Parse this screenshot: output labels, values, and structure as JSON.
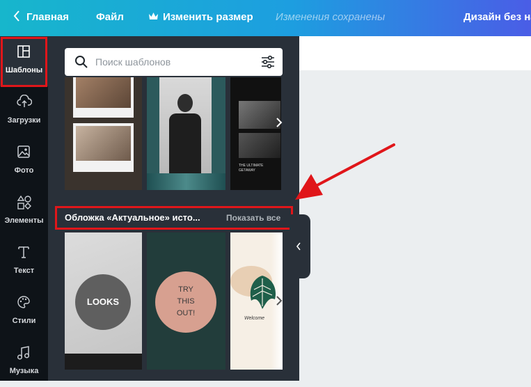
{
  "topbar": {
    "home": "Главная",
    "file": "Файл",
    "resize": "Изменить размер",
    "saved_status": "Изменения сохранены",
    "design_title": "Дизайн без на"
  },
  "sidebar": {
    "items": [
      {
        "label": "Шаблоны",
        "icon": "templates-icon",
        "active": true
      },
      {
        "label": "Загрузки",
        "icon": "upload-cloud-icon"
      },
      {
        "label": "Фото",
        "icon": "photo-icon"
      },
      {
        "label": "Элементы",
        "icon": "elements-icon"
      },
      {
        "label": "Текст",
        "icon": "text-icon"
      },
      {
        "label": "Стили",
        "icon": "palette-icon"
      },
      {
        "label": "Музыка",
        "icon": "music-note-icon"
      }
    ]
  },
  "search": {
    "placeholder": "Поиск шаблонов"
  },
  "section": {
    "title": "Обложка «Актуальное» исто...",
    "show_all": "Показать все"
  },
  "templates": {
    "row2_texts": [
      "LOOKS",
      "TRY",
      "THIS",
      "OUT!",
      "Welcome"
    ],
    "row1_caption": "THE ULTIMATE GETAWAY"
  },
  "colors": {
    "highlight": "#e0161a",
    "panel": "#293039",
    "sidebar": "#0e1318",
    "canvas": "#ebeef0"
  }
}
